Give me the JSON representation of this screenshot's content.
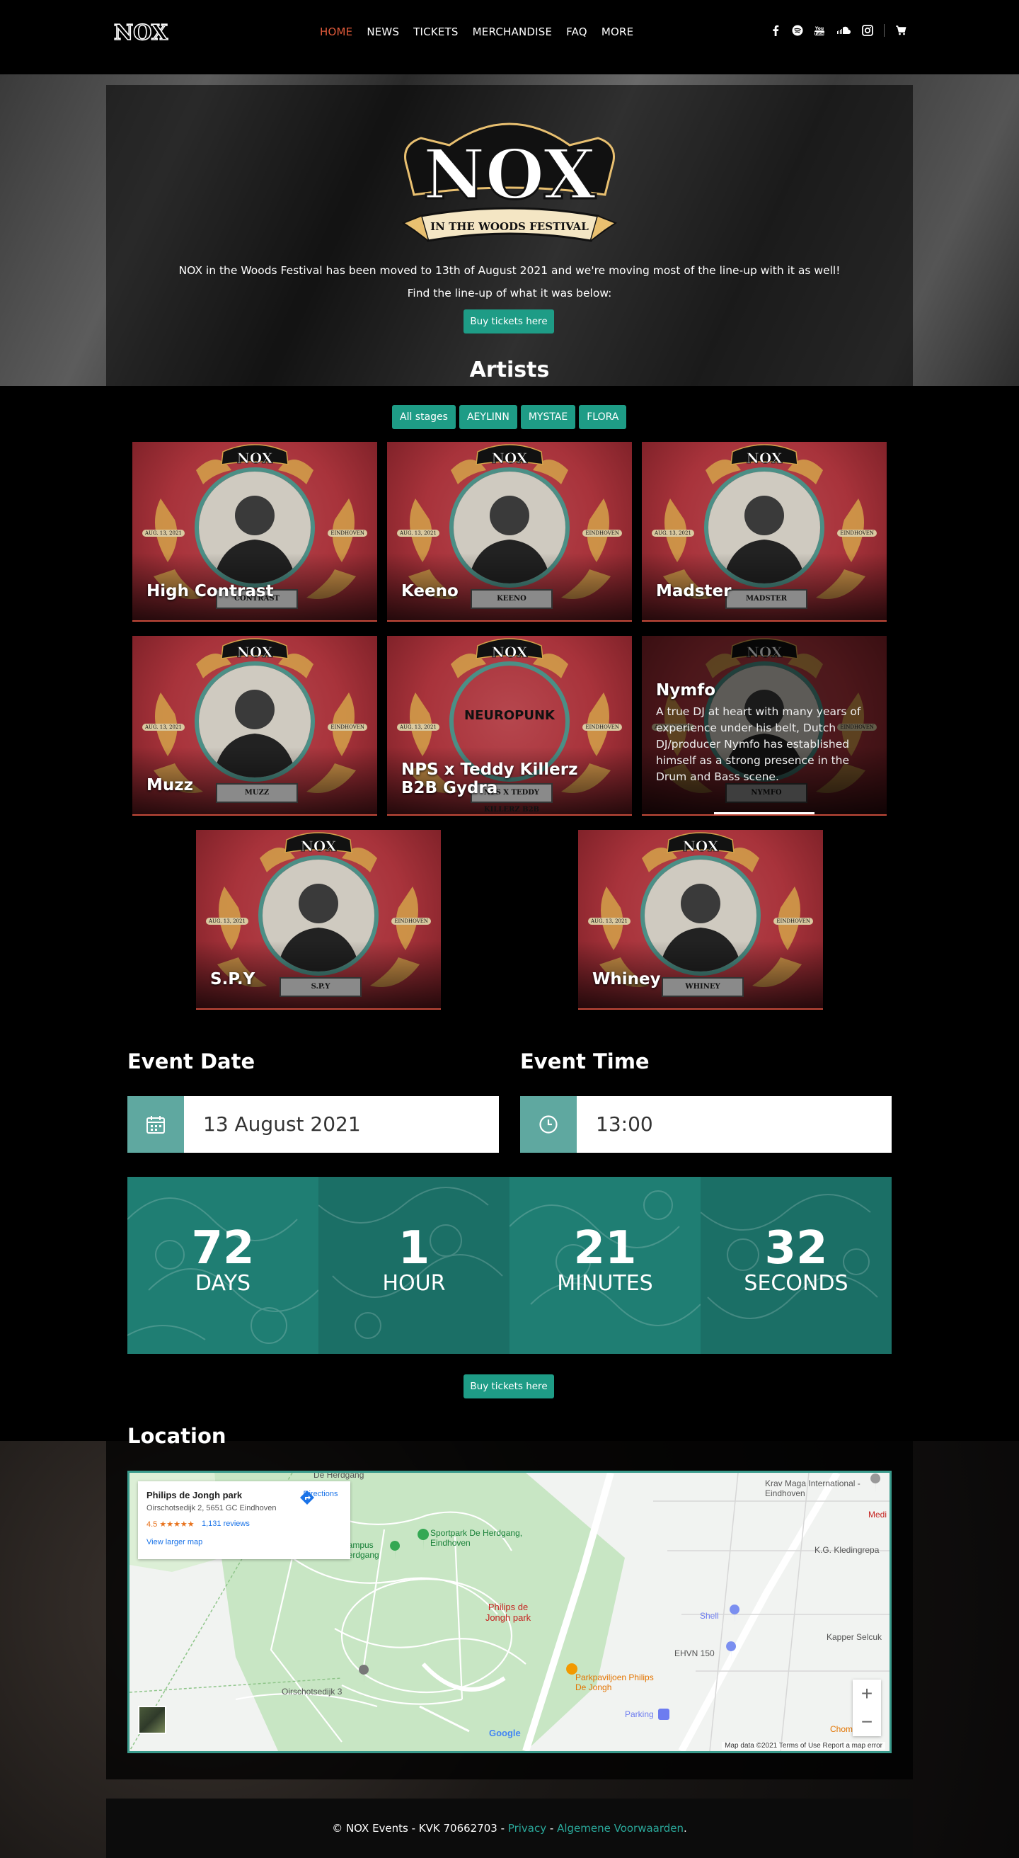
{
  "nav": {
    "items": [
      {
        "label": "HOME",
        "active": true
      },
      {
        "label": "NEWS"
      },
      {
        "label": "TICKETS"
      },
      {
        "label": "MERCHANDISE"
      },
      {
        "label": "FAQ"
      },
      {
        "label": "MORE"
      }
    ],
    "social_icons": [
      "facebook-icon",
      "spotify-icon",
      "youtube-icon",
      "soundcloud-icon",
      "instagram-icon"
    ],
    "cart_icon": "cart-icon"
  },
  "brand": {
    "logo_text": "NOX",
    "logo_ribbon": "IN THE WOODS FESTIVAL"
  },
  "hero": {
    "line1": "NOX in the Woods Festival has been moved to 13th of August 2021 and we're moving most of the line-up with it as well!",
    "line2": "Find the line-up of what it was below:",
    "button": "Buy tickets here"
  },
  "artists": {
    "title": "Artists",
    "filters": [
      "All stages",
      "AEYLINN",
      "MYSTAE",
      "FLORA"
    ],
    "card_date": "AUG. 13, 2021",
    "card_city": "EINDHOVEN",
    "items": [
      {
        "name": "High Contrast",
        "plate": "CONTRAST"
      },
      {
        "name": "Keeno",
        "plate": "KEENO"
      },
      {
        "name": "Madster",
        "plate": "MADSTER"
      },
      {
        "name": "Muzz",
        "plate": "MUZZ"
      },
      {
        "name": "NPS x Teddy Killerz B2B Gydra",
        "plate": "NPS X TEDDY KILLERZ B2B GYDRA",
        "center_text": "NEUROPUNK"
      },
      {
        "name": "Nymfo",
        "plate": "NYMFO",
        "description": "A true DJ at heart with many years of experience under his belt, Dutch DJ/producer Nymfo has established himself as a strong presence in the Drum and Bass scene."
      },
      {
        "name": "S.P.Y",
        "plate": "S.P.Y"
      },
      {
        "name": "Whiney",
        "plate": "WHINEY"
      }
    ]
  },
  "event": {
    "date_title": "Event Date",
    "date_value": "13 August 2021",
    "time_title": "Event Time",
    "time_value": "13:00"
  },
  "countdown": [
    {
      "value": "72",
      "unit": "DAYS"
    },
    {
      "value": "1",
      "unit": "HOUR"
    },
    {
      "value": "21",
      "unit": "MINUTES"
    },
    {
      "value": "32",
      "unit": "SECONDS"
    }
  ],
  "buy_button": "Buy tickets here",
  "location": {
    "title": "Location",
    "place": "Philips de Jongh park",
    "address": "Oirschotsedijk 2, 5651 GC Eindhoven",
    "rating": "4.5 ★★★★★",
    "reviews": "1,131 reviews",
    "larger": "View larger map",
    "directions": "Directions",
    "labels": {
      "herdgang": "De Herdgang",
      "sportpark": "Sportpark De Herdgang, Eindhoven",
      "campus": "Campus Herdgang",
      "park": "Philips de Jongh park",
      "paviljoen": "Parkpaviljoen Philips De Jongh",
      "oirschot": "Oirschotsedijk 3",
      "parking": "Parking",
      "shell": "Shell",
      "ehvn": "EHVN 150",
      "kravmaga": "Krav Maga International - Eindhoven",
      "medi": "Medi",
      "kg": "K.G. Kledingrepa",
      "kapper": "Kapper Selcuk",
      "chom": "Chom",
      "google": "Google"
    },
    "footer": "Map data ©2021   Terms of Use   Report a map error"
  },
  "footer": {
    "text": "© NOX Events - KVK 70662703 - ",
    "privacy": "Privacy",
    "dash": " - ",
    "terms": "Algemene Voorwaarden",
    "end": "."
  },
  "colors": {
    "accent": "#1e9c86",
    "nav_active": "#e05a3a",
    "card_red": "#a8333b",
    "field_icon": "#5fa8a0"
  }
}
